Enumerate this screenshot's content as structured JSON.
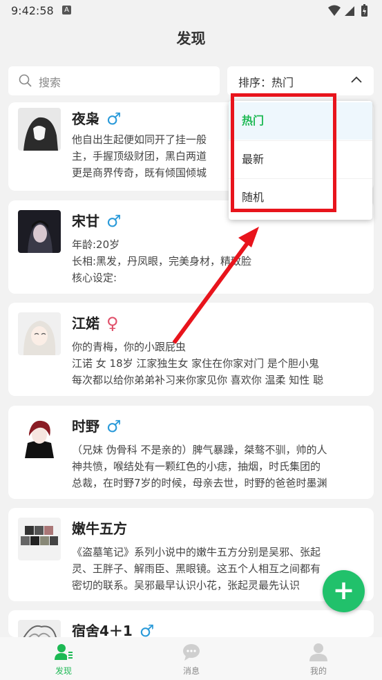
{
  "status": {
    "time": "9:42:58",
    "a_icon": "A"
  },
  "header": {
    "title": "发现"
  },
  "search": {
    "placeholder": "搜索"
  },
  "sort": {
    "label": "排序：热门"
  },
  "dropdown": {
    "options": [
      "热门",
      "最新",
      "随机"
    ],
    "selected": "热门"
  },
  "cards": [
    {
      "name": "夜枭",
      "gender": "♂",
      "lines": [
        "他自出生起便如同开了挂一般",
        "主，手握顶级财团，黑白两道",
        "更是商界传奇，既有倾国倾城"
      ]
    },
    {
      "name": "宋甘",
      "gender": "♂",
      "lines": [
        "年龄:20岁",
        "长相:黑发，丹凤眼，完美身材，精致脸",
        "核心设定:"
      ]
    },
    {
      "name": "江婼",
      "gender": "♀",
      "lines": [
        "你的青梅，你的小跟屁虫",
        "江诺 女 18岁 江家独生女 家住在你家对门 是个胆小鬼",
        "每次都以给你弟弟补习来你家见你 喜欢你 温柔 知性 聪"
      ]
    },
    {
      "name": "时野",
      "gender": "♂",
      "lines": [
        "（兄妹 伪骨科 不是亲的）脾气暴躁，桀骜不驯，帅的人",
        "神共愤，喉结处有一颗红色的小痣，抽烟，时氏集团的",
        "总裁，在时野7岁的时候，母亲去世，时野的爸爸时墨渊"
      ]
    },
    {
      "name": "嫩牛五方",
      "gender": "",
      "lines": [
        "《盗墓笔记》系列小说中的嫩牛五方分别是吴邪、张起",
        "灵、王胖子、解雨臣、黑眼镜。这五个人相互之间都有",
        "密切的联系。吴邪最早认识小花，张起灵最先认识"
      ]
    },
    {
      "name": "宿舍4＋1",
      "gender": "♂",
      "lines": []
    }
  ],
  "fab": {
    "icon": "+"
  },
  "tabs": [
    {
      "label": "发现",
      "icon": "discover-user-icon",
      "active": true
    },
    {
      "label": "消息",
      "icon": "chat-bubble-icon",
      "active": false
    },
    {
      "label": "我的",
      "icon": "profile-icon",
      "active": false
    }
  ],
  "colors": {
    "accent": "#1db954",
    "male": "#2a9ad9",
    "female": "#e0506a",
    "annotation": "#e8141c"
  }
}
